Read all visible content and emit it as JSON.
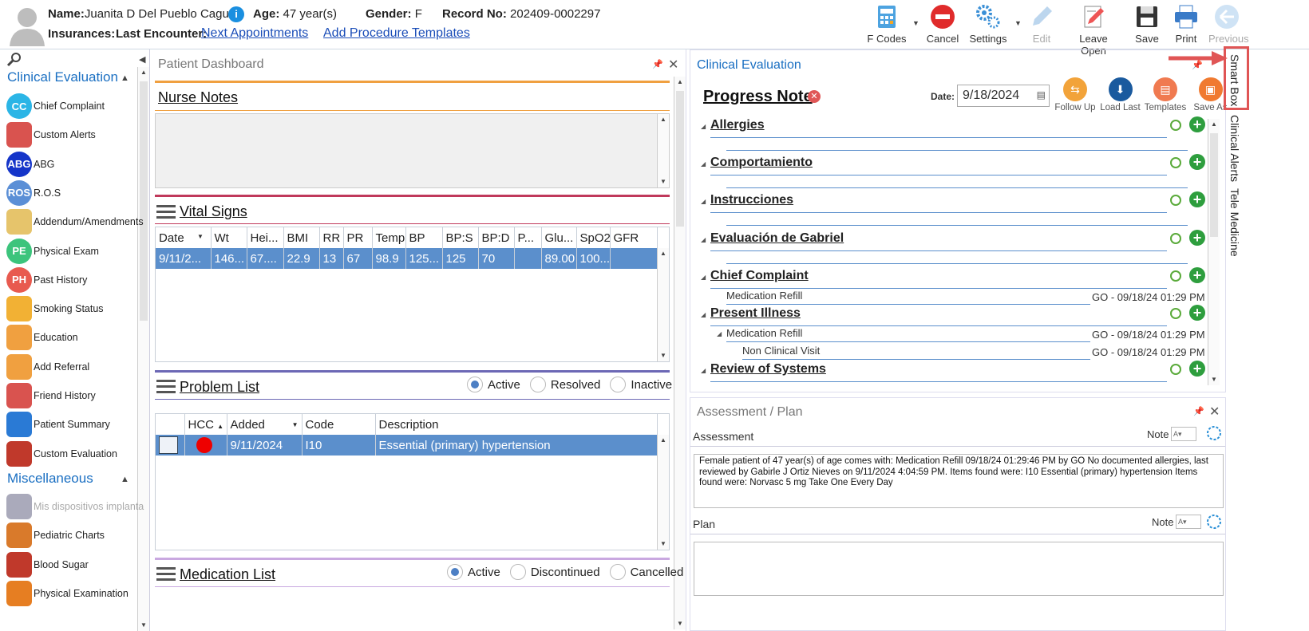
{
  "header": {
    "name_label": "Name:",
    "name": "Juanita D Del Pueblo Caguas",
    "age_label": "Age:",
    "age": "47 year(s)",
    "gender_label": "Gender:",
    "gender": "F",
    "record_label": "Record No:",
    "record": "202409-0002297",
    "insurances_label": "Insurances:",
    "last_encounter_label": "Last Encounter:",
    "next_appointments": "Next Appointments",
    "add_procedure_templates": "Add Procedure Templates"
  },
  "toolbar": {
    "fcodes": "F Codes",
    "cancel": "Cancel",
    "settings": "Settings",
    "edit": "Edit",
    "leave_open": "Leave Open",
    "save": "Save",
    "print": "Print",
    "previous": "Previous"
  },
  "nav": {
    "clinical_header": "Clinical Evaluation",
    "clinical_items": [
      {
        "label": "Chief Complaint",
        "abbr": "CC",
        "color": "#2bb5e6"
      },
      {
        "label": "Custom Alerts",
        "abbr": "",
        "color": "#d9534f"
      },
      {
        "label": "ABG",
        "abbr": "ABG",
        "color": "#1535c9"
      },
      {
        "label": "R.O.S",
        "abbr": "ROS",
        "color": "#5b8fd6"
      },
      {
        "label": "Addendum/Amendments",
        "abbr": "",
        "color": "#e6c46b"
      },
      {
        "label": "Physical Exam",
        "abbr": "PE",
        "color": "#3cc47c"
      },
      {
        "label": "Past History",
        "abbr": "PH",
        "color": "#e85a4f"
      },
      {
        "label": "Smoking Status",
        "abbr": "",
        "color": "#f2b134"
      },
      {
        "label": "Education",
        "abbr": "",
        "color": "#f0a040"
      },
      {
        "label": "Add Referral",
        "abbr": "",
        "color": "#f0a040"
      },
      {
        "label": "Friend History",
        "abbr": "",
        "color": "#d9534f"
      },
      {
        "label": "Patient Summary",
        "abbr": "",
        "color": "#2a7ad5"
      },
      {
        "label": "Custom Evaluation",
        "abbr": "",
        "color": "#c0392b"
      }
    ],
    "misc_header": "Miscellaneous",
    "misc_items": [
      {
        "label": "Mis dispositivos implanta",
        "abbr": "",
        "color": "#aab"
      },
      {
        "label": "Pediatric Charts",
        "abbr": "",
        "color": "#d97a2b"
      },
      {
        "label": "Blood Sugar",
        "abbr": "",
        "color": "#c0392b"
      },
      {
        "label": "Physical Examination",
        "abbr": "",
        "color": "#e67e22"
      }
    ]
  },
  "dashboard": {
    "title": "Patient Dashboard",
    "nurse_notes": "Nurse Notes",
    "vital_signs": "Vital Signs",
    "vital_cols": [
      "Date",
      "Wt",
      "Hei...",
      "BMI",
      "RR",
      "PR",
      "Temp",
      "BP",
      "BP:S",
      "BP:D",
      "P...",
      "Glu...",
      "SpO2",
      "GFR"
    ],
    "vital_row": [
      "9/11/2...",
      "146...",
      "67....",
      "22.9",
      "13",
      "67",
      "98.9",
      "125...",
      "125",
      "70",
      "",
      "89.00",
      "100...",
      ""
    ],
    "problem_list": "Problem List",
    "problem_filters": [
      "Active",
      "Resolved",
      "Inactive"
    ],
    "problem_cols": [
      "",
      "HCC",
      "Added",
      "Code",
      "Description"
    ],
    "problem_row": {
      "added": "9/11/2024",
      "code": "I10",
      "description": "Essential (primary) hypertension"
    },
    "medication_list": "Medication List",
    "medication_filters": [
      "Active",
      "Discontinued",
      "Cancelled"
    ]
  },
  "clinical": {
    "title": "Clinical Evaluation",
    "note_title": "Progress Note",
    "date_label": "Date:",
    "date": "9/18/2024",
    "actions": [
      "Follow Up",
      "Load Last",
      "Templates",
      "Save As"
    ],
    "sections": [
      "Allergies",
      "Comportamiento",
      "Instrucciones",
      "Evaluación de Gabriel",
      "Chief Complaint",
      "Present Illness",
      "Review of Systems"
    ],
    "cc_item": "Medication Refill",
    "cc_tag": "GO - 09/18/24 01:29 PM",
    "pi_item": "Medication Refill",
    "pi_tag": "GO - 09/18/24 01:29 PM",
    "pi_sub": "Non Clinical Visit",
    "pi_sub_tag": "GO - 09/18/24 01:29 PM"
  },
  "assessment": {
    "title": "Assessment / Plan",
    "assessment_label": "Assessment",
    "note_label": "Note",
    "assessment_text": "Female patient of 47 year(s) of age comes with:   Medication Refill   09/18/24 01:29:46 PM by GO     No documented allergies, last reviewed by Gabirle J Ortiz Nieves on 9/11/2024 4:04:59 PM.     Items found were:  I10 Essential (primary) hypertension  Items found were:  Norvasc 5 mg Take One Every Day",
    "plan_label": "Plan",
    "plan_note_label": "Note"
  },
  "right_tabs": [
    "Smart Box",
    "Clinical Alerts",
    "Tele Medicine"
  ]
}
